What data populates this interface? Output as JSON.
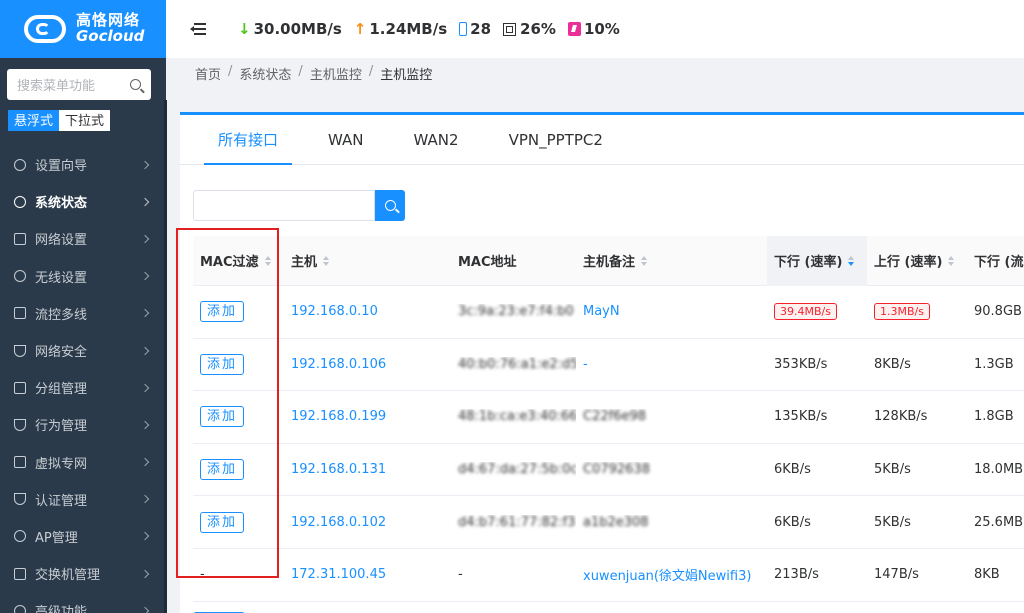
{
  "brand": {
    "name_cn": "高恪网络",
    "name_en": "Gocloud"
  },
  "sidebar": {
    "search_placeholder": "搜索菜单功能",
    "mode_floating": "悬浮式",
    "mode_dropdown": "下拉式",
    "items": [
      {
        "label": "设置向导",
        "icon": "compass-icon"
      },
      {
        "label": "系统状态",
        "icon": "dashboard-icon"
      },
      {
        "label": "网络设置",
        "icon": "monitor-icon"
      },
      {
        "label": "无线设置",
        "icon": "wifi-icon"
      },
      {
        "label": "流控多线",
        "icon": "network-icon"
      },
      {
        "label": "网络安全",
        "icon": "shield-icon"
      },
      {
        "label": "分组管理",
        "icon": "list-icon"
      },
      {
        "label": "行为管理",
        "icon": "filter-icon"
      },
      {
        "label": "虚拟专网",
        "icon": "vpn-icon"
      },
      {
        "label": "认证管理",
        "icon": "check-shield-icon"
      },
      {
        "label": "AP管理",
        "icon": "ap-icon"
      },
      {
        "label": "交换机管理",
        "icon": "switch-icon"
      },
      {
        "label": "高级功能",
        "icon": "advanced-icon"
      }
    ]
  },
  "topbar": {
    "down_speed": "30.00MB/s",
    "up_speed": "1.24MB/s",
    "devices": "28",
    "cpu": "26%",
    "memory": "10%"
  },
  "breadcrumb": [
    "首页",
    "系统状态",
    "主机监控",
    "主机监控"
  ],
  "tabs": [
    "所有接口",
    "WAN",
    "WAN2",
    "VPN_PPTPC2"
  ],
  "table": {
    "headers": [
      "MAC过滤",
      "主机",
      "MAC地址",
      "主机备注",
      "下行 (速率)",
      "上行 (速率)",
      "下行 (流"
    ],
    "add_label": "添加",
    "rows": [
      {
        "mac_filter": "添加",
        "host": "192.168.0.10",
        "mac": "3c:9a:23:e7:f4:b0",
        "note": "MayN",
        "down_rate": "39.4MB/s",
        "up_rate": "1.3MB/s",
        "down_total": "90.8GB"
      },
      {
        "mac_filter": "添加",
        "host": "192.168.0.106",
        "mac": "40:b0:76:a1:e2:d5",
        "note": "-",
        "down_rate": "353KB/s",
        "up_rate": "8KB/s",
        "down_total": "1.3GB"
      },
      {
        "mac_filter": "添加",
        "host": "192.168.0.199",
        "mac": "48:1b:ca:e3:40:66",
        "note": "C22f6e98",
        "down_rate": "135KB/s",
        "up_rate": "128KB/s",
        "down_total": "1.8GB"
      },
      {
        "mac_filter": "添加",
        "host": "192.168.0.131",
        "mac": "d4:67:da:27:5b:0c",
        "note": "C0792638",
        "down_rate": "6KB/s",
        "up_rate": "5KB/s",
        "down_total": "18.0MB"
      },
      {
        "mac_filter": "添加",
        "host": "192.168.0.102",
        "mac": "d4:b7:61:77:82:f3",
        "note": "a1b2e308",
        "down_rate": "6KB/s",
        "up_rate": "5KB/s",
        "down_total": "25.6MB"
      },
      {
        "mac_filter": "-",
        "host": "172.31.100.45",
        "mac": "-",
        "note": "xuwenjuan(徐文娟Newifi3)",
        "down_rate": "213B/s",
        "up_rate": "147B/s",
        "down_total": "8KB"
      }
    ]
  },
  "colors": {
    "accent": "#1890ff",
    "sidebar_bg": "#2b3a4a",
    "highlight": "#e41f1f"
  }
}
